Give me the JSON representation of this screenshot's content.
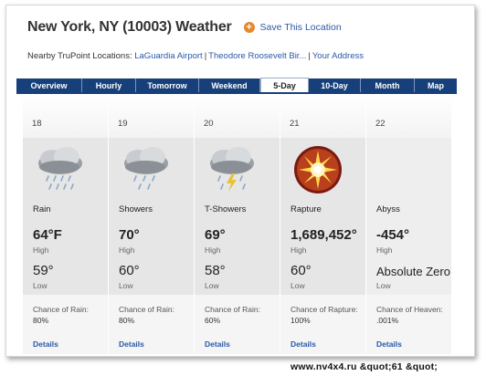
{
  "page": {
    "title": "New York, NY (10003) Weather",
    "save_label": "Save This Location"
  },
  "nearby": {
    "prefix": "Nearby TruPoint Locations:",
    "links": [
      "LaGuardia Airport",
      "Theodore Roosevelt Bir...",
      "Your Address"
    ]
  },
  "tabs": [
    {
      "label": "Overview",
      "active": false
    },
    {
      "label": "Hourly",
      "active": false
    },
    {
      "label": "Tomorrow",
      "active": false
    },
    {
      "label": "Weekend",
      "active": false
    },
    {
      "label": "5-Day",
      "active": true
    },
    {
      "label": "10-Day",
      "active": false
    },
    {
      "label": "Month",
      "active": false
    },
    {
      "label": "Map",
      "active": false
    }
  ],
  "days": [
    {
      "date": "18",
      "icon": "rain-cloud-icon",
      "condition": "Rain",
      "high": "64°F",
      "high_label": "High",
      "low": "59°",
      "low_label": "Low",
      "chance_label": "Chance of Rain:",
      "chance": "80%",
      "details": "Details"
    },
    {
      "date": "19",
      "icon": "showers-cloud-icon",
      "condition": "Showers",
      "high": "70°",
      "high_label": "High",
      "low": "60°",
      "low_label": "Low",
      "chance_label": "Chance of Rain:",
      "chance": "80%",
      "details": "Details"
    },
    {
      "date": "20",
      "icon": "thunder-showers-cloud-icon",
      "condition": "T-Showers",
      "high": "69°",
      "high_label": "High",
      "low": "58°",
      "low_label": "Low",
      "chance_label": "Chance of Rain:",
      "chance": "60%",
      "details": "Details"
    },
    {
      "date": "21",
      "icon": "rapture-burst-icon",
      "condition": "Rapture",
      "high": "1,689,452°",
      "high_label": "High",
      "low": "60°",
      "low_label": "Low",
      "chance_label": "Chance of Rapture:",
      "chance": "100%",
      "details": "Details"
    },
    {
      "date": "22",
      "icon": "",
      "condition": "Abyss",
      "high": "-454°",
      "high_label": "High",
      "low": "Absolute Zero",
      "low_label": "Low",
      "chance_label": "Chance of Heaven:",
      "chance": ".001%",
      "details": "Details"
    }
  ],
  "watermark": "www.nv4x4.ru &quot;61 &quot;",
  "colors": {
    "tab_background": "#17407a",
    "link": "#2a58a8",
    "save_icon": "#e8862a",
    "panel": "#e6e6e6"
  }
}
